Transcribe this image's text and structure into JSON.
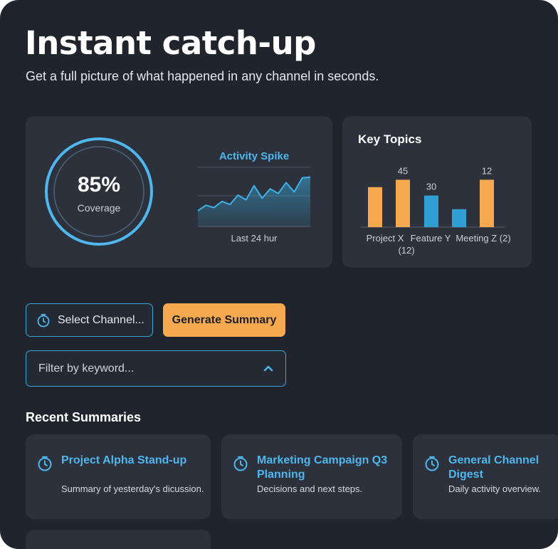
{
  "header": {
    "title": "Instant catch-up",
    "subtitle": "Get a full picture of what happened in any channel in seconds."
  },
  "stats": {
    "coverage_value": "85%",
    "coverage_label": "Coverage",
    "coverage_fraction": 0.85,
    "spike_title": "Activity Spike",
    "spike_caption": "Last 24 hur"
  },
  "chart_data": [
    {
      "type": "line",
      "title": "Activity Spike",
      "xlabel": "Last 24 hur",
      "values": [
        20,
        27,
        24,
        32,
        28,
        40,
        34,
        52,
        36,
        48,
        42,
        56,
        44,
        62,
        63
      ]
    },
    {
      "type": "bar",
      "title": "Key Topics",
      "categories": [
        "Project X (12)",
        "Feature Y",
        "Meeting Z (2)"
      ],
      "series": [
        {
          "values": [
            38,
            45,
            17,
            12
          ]
        },
        {
          "values": [
            null,
            30,
            null,
            null
          ]
        }
      ],
      "bars": [
        {
          "value": 38,
          "color": "#f7a950",
          "label": ""
        },
        {
          "value": 45,
          "color": "#f7a950",
          "label": "45"
        },
        {
          "value": 30,
          "color": "#2f9fd6",
          "label": "30"
        },
        {
          "value": 17,
          "color": "#2f9fd6",
          "label": ""
        },
        {
          "value": 45,
          "color": "#f7a950",
          "label": "12"
        }
      ],
      "ylim": [
        0,
        50
      ]
    }
  ],
  "topics": {
    "title": "Key Topics",
    "labels": [
      "Project X",
      "(12)",
      "Feature Y",
      "Meeting Z (2)"
    ]
  },
  "controls": {
    "select_label": "Select Channel...",
    "generate_label": "Generate Summary",
    "filter_placeholder": "Filter by keyword..."
  },
  "recent": {
    "title": "Recent Summaries",
    "items": [
      {
        "title": "Project Alpha Stand-up",
        "desc": "Summary of yesterday's dicussion."
      },
      {
        "title": "Marketing Campaign Q3 Planning",
        "desc": "Decisions and next steps."
      },
      {
        "title": "General Channel Digest",
        "desc": "Daily activity overview."
      }
    ]
  },
  "colors": {
    "accent_blue": "#4fb7ee",
    "accent_orange": "#f7a950",
    "background": "#20242d",
    "card": "#2c313b"
  }
}
